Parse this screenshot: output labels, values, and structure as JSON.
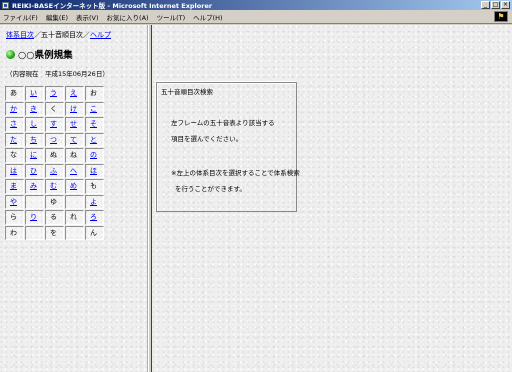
{
  "window": {
    "title": "REIKI-BASEインターネット版 - Microsoft Internet Explorer",
    "buttons": [
      "_",
      "□",
      "×"
    ]
  },
  "menu": [
    "ファイル(F)",
    "編集(E)",
    "表示(V)",
    "お気に入り(A)",
    "ツール(T)",
    "ヘルプ(H)"
  ],
  "breadcrumb": {
    "link1": "体系目次",
    "sep1": "／",
    "current": "五十音順目次",
    "sep2": "／",
    "link2": "ヘルプ"
  },
  "heading": "○○県例規集",
  "as_of": "（内容現在　平成15年06月26日）",
  "kana": [
    {
      "ch": "あ",
      "link": false
    },
    {
      "ch": "い",
      "link": true
    },
    {
      "ch": "う",
      "link": true
    },
    {
      "ch": "え",
      "link": true
    },
    {
      "ch": "お",
      "link": false
    },
    {
      "ch": "か",
      "link": true
    },
    {
      "ch": "き",
      "link": true
    },
    {
      "ch": "く",
      "link": false
    },
    {
      "ch": "け",
      "link": true
    },
    {
      "ch": "こ",
      "link": true
    },
    {
      "ch": "さ",
      "link": true
    },
    {
      "ch": "し",
      "link": true
    },
    {
      "ch": "す",
      "link": true
    },
    {
      "ch": "せ",
      "link": true
    },
    {
      "ch": "そ",
      "link": true
    },
    {
      "ch": "た",
      "link": true
    },
    {
      "ch": "ち",
      "link": true
    },
    {
      "ch": "つ",
      "link": true
    },
    {
      "ch": "て",
      "link": true
    },
    {
      "ch": "と",
      "link": true
    },
    {
      "ch": "な",
      "link": false
    },
    {
      "ch": "に",
      "link": true
    },
    {
      "ch": "ぬ",
      "link": false
    },
    {
      "ch": "ね",
      "link": false
    },
    {
      "ch": "の",
      "link": true
    },
    {
      "ch": "は",
      "link": true
    },
    {
      "ch": "ひ",
      "link": true
    },
    {
      "ch": "ふ",
      "link": true
    },
    {
      "ch": "へ",
      "link": true
    },
    {
      "ch": "ほ",
      "link": true
    },
    {
      "ch": "ま",
      "link": true
    },
    {
      "ch": "み",
      "link": true
    },
    {
      "ch": "む",
      "link": true
    },
    {
      "ch": "め",
      "link": true
    },
    {
      "ch": "も",
      "link": false
    },
    {
      "ch": "や",
      "link": true
    },
    {
      "ch": "",
      "link": false
    },
    {
      "ch": "ゆ",
      "link": false
    },
    {
      "ch": "",
      "link": false
    },
    {
      "ch": "よ",
      "link": true
    },
    {
      "ch": "ら",
      "link": false
    },
    {
      "ch": "り",
      "link": true
    },
    {
      "ch": "る",
      "link": false
    },
    {
      "ch": "れ",
      "link": false
    },
    {
      "ch": "ろ",
      "link": true
    },
    {
      "ch": "わ",
      "link": false
    },
    {
      "ch": "",
      "link": false
    },
    {
      "ch": "を",
      "link": false
    },
    {
      "ch": "",
      "link": false
    },
    {
      "ch": "ん",
      "link": false
    }
  ],
  "info": {
    "title": "五十音順目次検索",
    "line1": "左フレームの五十音表より該当する",
    "line2": "項目を選んでください。",
    "line3": "※左上の体系目次を選択することで体系検索",
    "line4": "を行うことができます。"
  }
}
